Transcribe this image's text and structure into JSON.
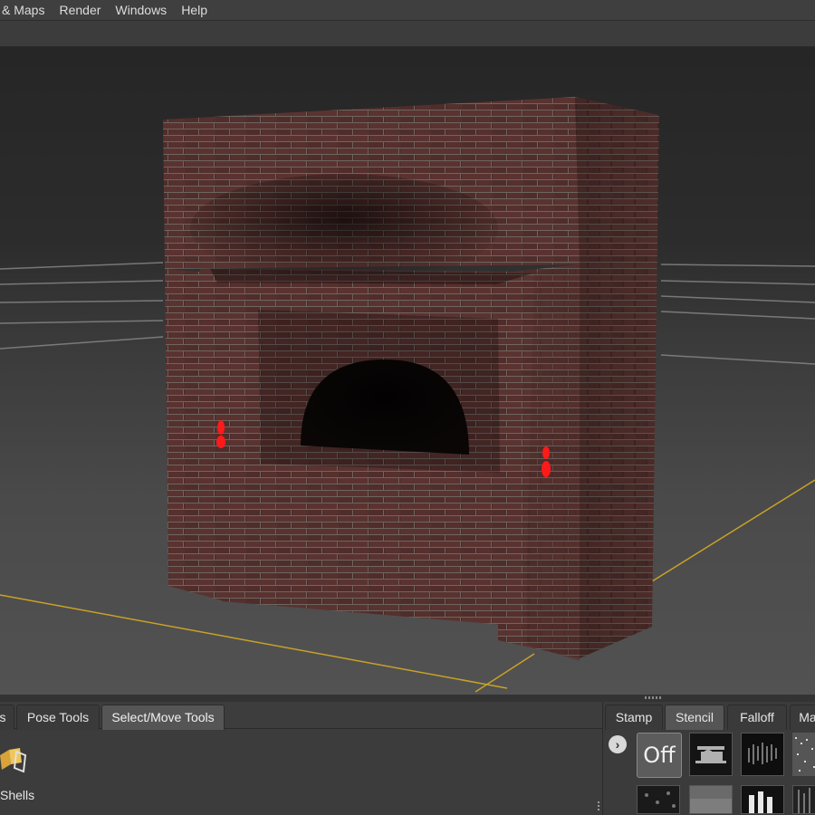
{
  "menubar": {
    "items": [
      {
        "label": "& Maps"
      },
      {
        "label": "Render"
      },
      {
        "label": "Windows"
      },
      {
        "label": "Help"
      }
    ]
  },
  "viewport": {
    "object": "brick-fireplace-model",
    "markers_color": "#ff1a1a",
    "grid_axis_color": "#c9a227"
  },
  "bottom_tabs": [
    {
      "label": "s"
    },
    {
      "label": "Pose Tools"
    },
    {
      "label": "Select/Move Tools",
      "active": true
    }
  ],
  "tools": {
    "shells_label": "Shells",
    "shells_icon": "shells-icon"
  },
  "right_tabs": [
    {
      "label": "Stamp"
    },
    {
      "label": "Stencil",
      "active": true
    },
    {
      "label": "Falloff"
    },
    {
      "label": "Ma"
    }
  ],
  "stencil": {
    "off_label": "Off",
    "expand_icon": "chevron-right-icon"
  },
  "colors": {
    "background": "#3a3a3a",
    "active_tab": "#555555",
    "brick": "#4a2a26"
  }
}
